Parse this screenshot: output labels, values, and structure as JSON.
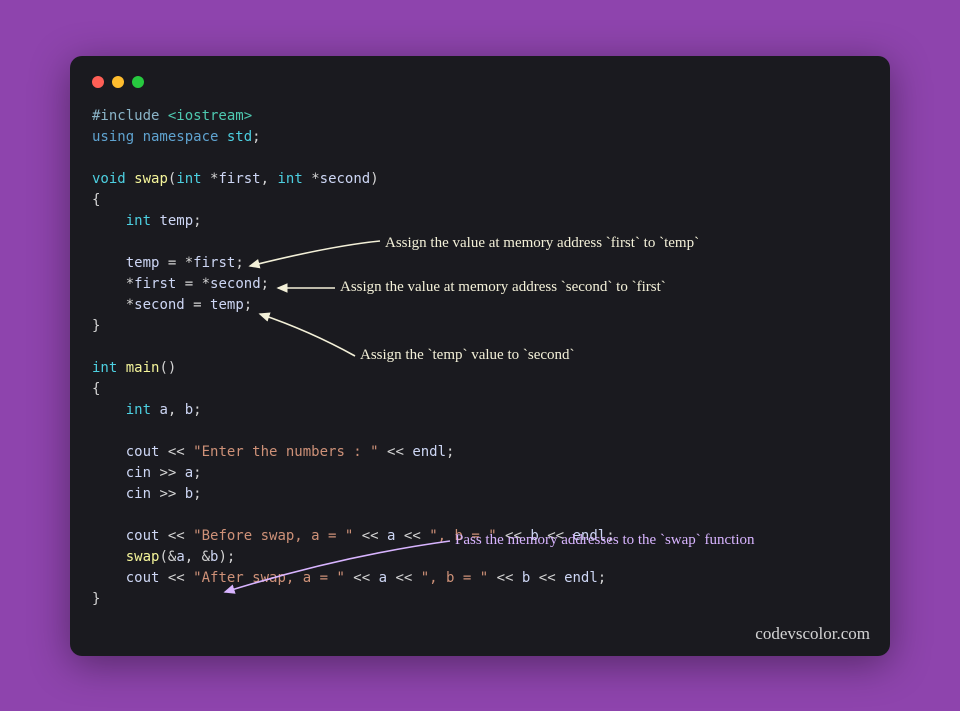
{
  "watermark": "codevscolor.com",
  "annotations": {
    "a1": "Assign the value at memory address `first` to `temp`",
    "a2": "Assign the value at memory address `second` to `first`",
    "a3": "Assign the `temp` value to `second`",
    "a4": "Pass the memory addresses to the `swap` function"
  },
  "colors": {
    "ann_white": "#f3f0d8",
    "ann_purple": "#d8b4ff"
  },
  "code": {
    "l1_pp": "#include ",
    "l1_inc": "<iostream>",
    "l2_kw1": "using ",
    "l2_kw2": "namespace ",
    "l2_ns": "std",
    "l2_sc": ";",
    "l4_ty": "void ",
    "l4_fn": "swap",
    "l4_op1": "(",
    "l4_ty2": "int ",
    "l4_op2": "*",
    "l4_p1": "first",
    "l4_op3": ", ",
    "l4_ty3": "int ",
    "l4_op4": "*",
    "l4_p2": "second",
    "l4_op5": ")",
    "l5_b": "{",
    "l6_ty": "int ",
    "l6_id": "temp",
    "l6_sc": ";",
    "l8_lhs": "temp",
    "l8_eq": " = ",
    "l8_st": "*",
    "l8_rhs": "first",
    "l8_sc": ";",
    "l9_st1": "*",
    "l9_lhs": "first",
    "l9_eq": " = ",
    "l9_st2": "*",
    "l9_rhs": "second",
    "l9_sc": ";",
    "l10_st": "*",
    "l10_lhs": "second",
    "l10_eq": " = ",
    "l10_rhs": "temp",
    "l10_sc": ";",
    "l11_b": "}",
    "l13_ty": "int ",
    "l13_fn": "main",
    "l13_p": "()",
    "l14_b": "{",
    "l15_ty": "int ",
    "l15_a": "a",
    "l15_c": ", ",
    "l15_b": "b",
    "l15_sc": ";",
    "l17_cout": "cout",
    "l17_op1": " << ",
    "l17_str": "\"Enter the numbers : \"",
    "l17_op2": " << ",
    "l17_endl": "endl",
    "l17_sc": ";",
    "l18_cin": "cin",
    "l18_op": " >> ",
    "l18_a": "a",
    "l18_sc": ";",
    "l19_cin": "cin",
    "l19_op": " >> ",
    "l19_b": "b",
    "l19_sc": ";",
    "l21_cout": "cout",
    "l21_op1": " << ",
    "l21_str1": "\"Before swap, a = \"",
    "l21_op2": " << ",
    "l21_a": "a",
    "l21_op3": " << ",
    "l21_str2": "\", b = \"",
    "l21_op4": " << ",
    "l21_b": "b",
    "l21_op5": " << ",
    "l21_endl": "endl",
    "l21_sc": ";",
    "l22_fn": "swap",
    "l22_op1": "(",
    "l22_amp1": "&",
    "l22_a": "a",
    "l22_c": ", ",
    "l22_amp2": "&",
    "l22_b": "b",
    "l22_op2": ");",
    "l23_cout": "cout",
    "l23_op1": " << ",
    "l23_str1": "\"After swap, a = \"",
    "l23_op2": " << ",
    "l23_a": "a",
    "l23_op3": " << ",
    "l23_str2": "\", b = \"",
    "l23_op4": " << ",
    "l23_b": "b",
    "l23_op5": " << ",
    "l23_endl": "endl",
    "l23_sc": ";",
    "l24_b": "}"
  }
}
